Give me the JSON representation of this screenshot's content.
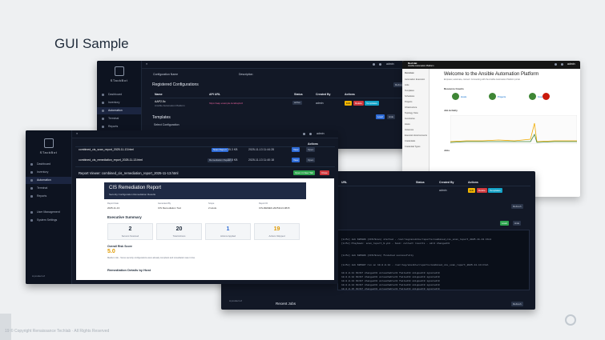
{
  "slide": {
    "title": "GUI Sample",
    "footer": "19  © Copyright Renaissance Techlab · All Rights Reserved"
  },
  "colors": {
    "slide_bg": "#eef0f2",
    "app_bg": "#121826",
    "sidebar_bg": "#0d1320",
    "accent_blue": "#2e6bd6"
  },
  "brand": {
    "name": "STackBot",
    "powered_by": "A product of"
  },
  "nav": {
    "dashboard": "Dashboard",
    "inventory": "Inventory",
    "automation": "Automation",
    "terminal": "Terminal",
    "reports": "Reports",
    "user_management": "User Management",
    "system_settings": "System Settings"
  },
  "user": {
    "name": "admin"
  },
  "config_screen": {
    "col_name": "Configuration Name",
    "col_desc": "Description",
    "refresh": "Refresh",
    "section_title": "Registered Configurations",
    "headers": {
      "name": "Name",
      "api_url": "API URL",
      "status": "Status",
      "created_by": "Created By",
      "actions": "Actions"
    },
    "row": {
      "name": "AAP2.5c",
      "desc": "Ansible Automation Platform",
      "api_url": "https://aap.example.local/api/v2",
      "status": "active",
      "created_by": "admin",
      "actions": [
        "Edit",
        "Delete",
        "Templates"
      ]
    },
    "templates_title": "Templates",
    "select_config": "Select Configuration",
    "load": "Load",
    "hide": "Hide"
  },
  "reports_screen": {
    "files": [
      {
        "name": "combined_cis_scan_report_2025-11-13.html",
        "type": "Scan Report",
        "size": "35.3 KB",
        "date": "2025-11-13 11:44:28"
      },
      {
        "name": "combined_cis_remediation_report_2025-11-13.html",
        "type": "Remediation Report",
        "size": "27.8 KB",
        "date": "2025-11-13 11:40:18"
      }
    ],
    "view": "View",
    "open": "Open",
    "actions_header": "Actions",
    "viewer_title": "Report Viewer: combined_cis_remediation_report_2025-11-13.html",
    "open_new_tab": "Open in New Tab",
    "close": "Close"
  },
  "report_doc": {
    "title": "CIS Remediation Report",
    "subtitle": "Security Configuration Remediation Results",
    "meta": [
      {
        "label": "Report Date",
        "value": "2025-11-13"
      },
      {
        "label": "Generated By",
        "value": "CIS Remediation Tool"
      },
      {
        "label": "Scope",
        "value": "2 Hosts"
      },
      {
        "label": "Report ID",
        "value": "CIS-REMED-20251113-0815"
      }
    ],
    "summary_title": "Executive Summary",
    "cards": [
      {
        "value": "2",
        "caption": "Servers Scanned"
      },
      {
        "value": "20",
        "caption": "Total Actions"
      },
      {
        "value": "1",
        "caption": "Actions Applied"
      },
      {
        "value": "19",
        "caption": "Actions Skipped"
      }
    ],
    "risk_title": "Overall Risk Score",
    "risk_value": "5.0",
    "risk_note": "Medium risk - Some security configurations were already compliant and remediation was in line.",
    "details_title": "Remediation Details by Host"
  },
  "aap": {
    "brand": "Red Hat",
    "product": "Ansible Automation Platform",
    "welcome": "Welcome to the Ansible Automation Platform",
    "welcome_sub": "Empower, automate, connect: Connecting with the Ansible Automation Platform portal.",
    "resource_counts": "Resource Counts",
    "hosts": "Hosts",
    "projects": "Projects",
    "inventories": "Inventories",
    "job_activity": "Job Activity",
    "jobs": "Jobs",
    "side_items": [
      "Overview",
      "Automation Execution",
      "Jobs",
      "Templates",
      "Schedules",
      "Projects",
      "Infrastructure",
      "Topology View",
      "Inventories",
      "Hosts",
      "Instances",
      "Execution Environments",
      "Credentials",
      "Credential Types"
    ]
  },
  "terminal_screen": {
    "url_header": "URL",
    "status_header": "Status",
    "created_by_header": "Created By",
    "actions_header": "Actions",
    "refresh": "Refresh",
    "load": "Load",
    "hide": "Hide",
    "recent_jobs": "Recent Jobs",
    "log_lines": [
      "[info] Job 685906 (CIS/Scan) started - /var/log/ansible/reports/combined_cis_scan_report_2025-11-13.html",
      "[info] Playbook: scan_report_9.yml - task: collect results - ok=4 changed=0",
      "[info] Job 685906 (CIS/Scan) finished successfully",
      "[info] Job 685907 run on 10.0.0.12 - /var/log/ansible/reports/combined_cis_scan_report_2025-11-13.html"
    ],
    "table_rows": [
      {
        "host": "10.0.0.11",
        "a": "Ok=97",
        "b": "changed=0",
        "c": "unreachable=0",
        "d": "failed=0",
        "e": "skipped=0",
        "f": "ignored=0"
      },
      {
        "host": "10.0.0.12",
        "a": "Ok=97",
        "b": "changed=0",
        "c": "unreachable=0",
        "d": "failed=0",
        "e": "skipped=0",
        "f": "ignored=0"
      },
      {
        "host": "10.0.0.13",
        "a": "Ok=97",
        "b": "changed=0",
        "c": "unreachable=0",
        "d": "failed=0",
        "e": "skipped=0",
        "f": "ignored=0"
      },
      {
        "host": "10.0.0.14",
        "a": "Ok=97",
        "b": "changed=0",
        "c": "unreachable=0",
        "d": "failed=0",
        "e": "skipped=0",
        "f": "ignored=0"
      },
      {
        "host": "10.0.0.15",
        "a": "Ok=97",
        "b": "changed=0",
        "c": "unreachable=0",
        "d": "failed=0",
        "e": "skipped=0",
        "f": "ignored=0"
      }
    ]
  }
}
